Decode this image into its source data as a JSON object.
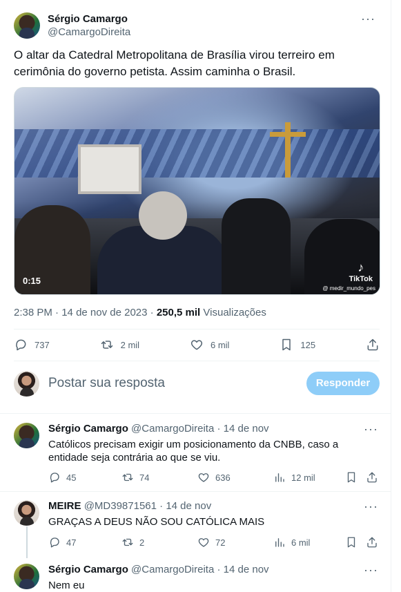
{
  "tweet": {
    "author_name": "Sérgio Camargo",
    "author_handle": "@CamargoDireita",
    "more_icon": "more-icon",
    "text": "O altar da Catedral Metropolitana de Brasília virou terreiro em cerimônia do governo petista. Assim caminha o Brasil.",
    "video": {
      "duration": "0:15",
      "watermark": "TikTok",
      "watermark_user": "@ medir_mundo_pes"
    },
    "time": "2:38 PM",
    "date": "14 de nov de 2023",
    "views_count": "250,5 mil",
    "views_label": "Visualizações",
    "separator": "·",
    "stats": {
      "replies": "737",
      "retweets": "2 mil",
      "likes": "6 mil",
      "bookmarks": "125"
    }
  },
  "composer": {
    "placeholder": "Postar sua resposta",
    "button": "Responder"
  },
  "replies": [
    {
      "name": "Sérgio Camargo",
      "handle": "@CamargoDireita",
      "date": "14 de nov",
      "text": "Católicos precisam exigir um posicionamento da CNBB, caso a entidade seja contrária ao que se viu.",
      "replies": "45",
      "retweets": "74",
      "likes": "636",
      "views": "12 mil"
    },
    {
      "name": "MEIRE",
      "handle": "@MD39871561",
      "date": "14 de nov",
      "text": "GRAÇAS A DEUS NÃO SOU CATÓLICA MAIS",
      "replies": "47",
      "retweets": "2",
      "likes": "72",
      "views": "6 mil"
    },
    {
      "name": "Sérgio Camargo",
      "handle": "@CamargoDireita",
      "date": "14 de nov",
      "text": "Nem eu"
    }
  ],
  "colors": {
    "accent_disabled": "#8ecdf8",
    "muted": "#536471",
    "text": "#0f1419",
    "border": "#eff3f4"
  }
}
